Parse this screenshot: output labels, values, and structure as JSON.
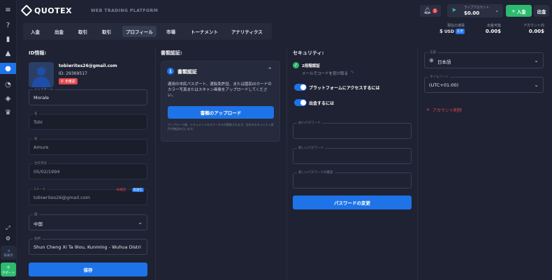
{
  "brand": {
    "name": "QUOTEX",
    "tagline": "WEB TRADING PLATFORM"
  },
  "header": {
    "notification_count": "1",
    "account_type_label": "ライブアカウント",
    "account_balance": "$0.00",
    "deposit_label": "入金",
    "withdraw_label": "出金"
  },
  "tabs": [
    {
      "label": "入金"
    },
    {
      "label": "出金"
    },
    {
      "label": "取引"
    },
    {
      "label": "取引"
    },
    {
      "label": "プロフィール",
      "active": true
    },
    {
      "label": "市場"
    },
    {
      "label": "トーナメント"
    },
    {
      "label": "アナリティクス"
    }
  ],
  "balances": {
    "currency_label": "現在の通貨",
    "currency_value": "USD",
    "currency_change": "変更",
    "withdrawable_label": "出金可能",
    "withdrawable_value": "0.00$",
    "account_label": "アカウント内",
    "account_value": "0.00$"
  },
  "id_info": {
    "heading": "ID情報:",
    "email": "tobiwrites26@gmail.com",
    "user_id": "ID: 29369517",
    "unverified_badge": "未確認",
    "fields": {
      "nickname": {
        "label": "ニックネーム",
        "value": "Morale"
      },
      "first_name": {
        "label": "名",
        "value": "Tobi"
      },
      "last_name": {
        "label": "姓",
        "value": "Amure"
      },
      "birthday": {
        "label": "生年月日",
        "value": "05/02/1994"
      },
      "email": {
        "label": "Eメール",
        "value": "tobiwrites26@gmail.com",
        "status": "未確認",
        "action": "再送信"
      },
      "country": {
        "label": "国",
        "value": "中国"
      },
      "address": {
        "label": "住所",
        "value": "Shun Cheng Xi Ta 9lou, Kunming - Wuhua Distri"
      }
    },
    "save_label": "保存"
  },
  "documents": {
    "heading": "書類認証:",
    "card_title": "書類認証",
    "card_step": "1",
    "card_text": "適用の市民パスポート、運転免許証、または国民IDカードのカラー写真またはスキャン画像をアップロードしてください。",
    "upload_label": "書類のアップロード",
    "note": "アップロード後、ドキュメントのステータスが更新されます。当社のセキュリティ部門が確認を行います。"
  },
  "security": {
    "heading": "セキュリティ:",
    "two_factor_title": "2段階認証",
    "two_factor_sub": "メールでコードを受け取る",
    "toggle_platform": "プラットフォームにアクセスするには",
    "toggle_withdraw": "出金するには",
    "old_password": "古いパスワード",
    "new_password": "新しいパスワード",
    "confirm_password": "新しいパスワードの確認",
    "change_password_label": "パスワードの変更"
  },
  "settings": {
    "language_label": "言語",
    "language_value": "日本語",
    "timezone_label": "タイムゾーン",
    "timezone_value": "(UTC+01:00)",
    "delete_account": "アカウント削除"
  },
  "sidebar_bottom": {
    "collapse_label": "非表示",
    "chat_label": "サポート"
  },
  "colors": {
    "accent": "#1e73e8",
    "green": "#2dba6f",
    "danger": "#e0474c",
    "background": "#1e2232"
  }
}
